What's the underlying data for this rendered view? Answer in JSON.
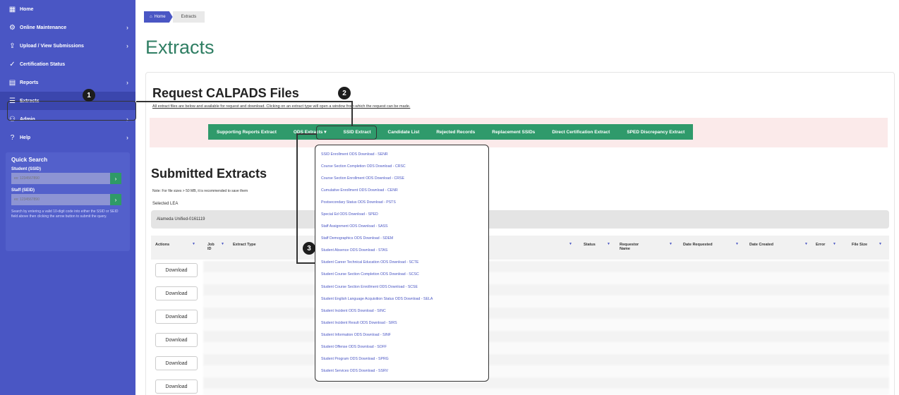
{
  "sidebar": {
    "items": [
      {
        "label": "Home",
        "icon": "grid-icon",
        "chevron": false
      },
      {
        "label": "Online Maintenance",
        "icon": "gear-icon",
        "chevron": true
      },
      {
        "label": "Upload / View Submissions",
        "icon": "upload-icon",
        "chevron": true
      },
      {
        "label": "Certification Status",
        "icon": "check-circle-icon",
        "chevron": false
      },
      {
        "label": "Reports",
        "icon": "document-icon",
        "chevron": true
      },
      {
        "label": "Extracts",
        "icon": "database-icon",
        "chevron": false
      },
      {
        "label": "Admin",
        "icon": "user-icon",
        "chevron": true
      },
      {
        "label": "Help",
        "icon": "help-icon",
        "chevron": true
      }
    ],
    "quick_search": {
      "title": "Quick Search",
      "student_label": "Student (SSID)",
      "student_placeholder": "ex: 1234567890",
      "staff_label": "Staff (SEID)",
      "staff_placeholder": "ex: 1234567890",
      "hint": "Search by entering a valid 10-digit code into either the SSID or SEID field above then clicking the arrow button to submit the query."
    }
  },
  "breadcrumb": {
    "home": "Home",
    "current": "Extracts"
  },
  "page_title": "Extracts",
  "request": {
    "title": "Request CALPADS Files",
    "description": "All extract files are below and available for request and download. Clicking on an extract type will open a window from which the request can be made."
  },
  "tabs": [
    "Supporting Reports Extract",
    "ODS Extracts ▾",
    "SSID Extract",
    "Candidate List",
    "Rejected Records",
    "Replacement SSIDs",
    "Direct Certification Extract",
    "SPED Discrepancy Extract"
  ],
  "dropdown_items": [
    "SSID Enrollment ODS Download - SENR",
    "Course Section Completion ODS Download - CRSC",
    "Course Section Enrollment ODS Download - CRSE",
    "Cumulative Enrollment ODS Download - CENR",
    "Postsecondary Status ODS Download - PSTS",
    "Special Ed ODS Download - SPED",
    "Staff Assignment ODS Download - SASS",
    "Staff Demographics ODS Download - SDEM",
    "Student Absence ODS Download - STAS",
    "Student Career Technical Education ODS Download - SCTE",
    "Student Course Section Completion ODS Download - SCSC",
    "Student Course Section Enrollment ODS Download - SCSE",
    "Student English Language Acquisition Status ODS Download - SELA",
    "Student Incident ODS Download - SINC",
    "Student Incident Result ODS Download - SIRS",
    "Student Information ODS Download - SINF",
    "Student Offense ODS Download - SOFF",
    "Student Program ODS Download - SPRG",
    "Student Services ODS Download - SSRV"
  ],
  "submitted": {
    "title": "Submitted Extracts",
    "note": "Note: For file sizes > 50 MB, it is recommended to save them",
    "selected_lea_label": "Selected LEA",
    "selected_lea_value": "Alameda Unified-0161119",
    "columns": {
      "actions": "Actions",
      "job_id": "Job ID",
      "extract_type": "Extract Type",
      "status": "Status",
      "requestor": "Requestor Name",
      "date_requested": "Date Requested",
      "date_created": "Date Created",
      "error": "Error",
      "file_size": "File Size"
    },
    "download_label": "Download",
    "row_count": 6
  },
  "callouts": [
    "1",
    "2",
    "3"
  ],
  "colors": {
    "sidebar": "#4a56c4",
    "accent_green": "#2f9a6b",
    "title_green": "#2f7e63"
  }
}
